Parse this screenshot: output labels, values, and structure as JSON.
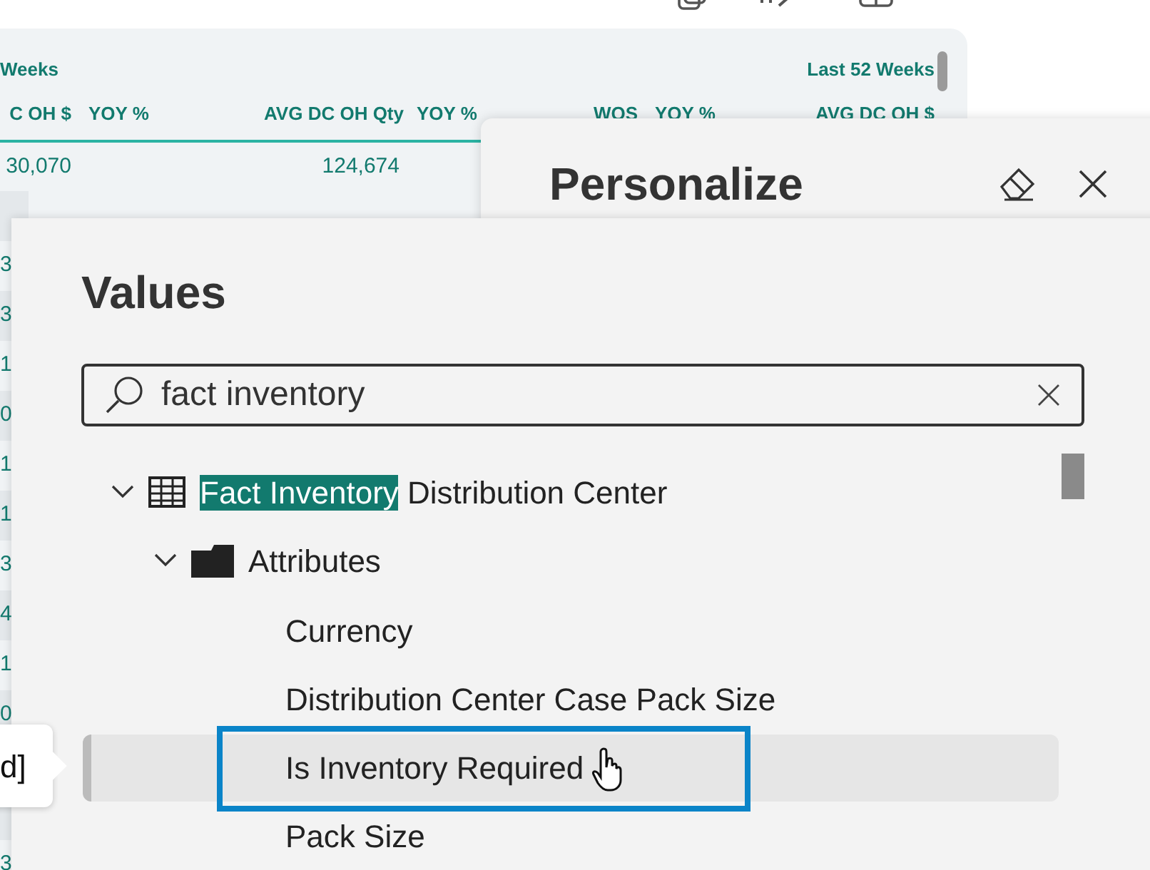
{
  "report": {
    "header_groups": [
      "Weeks",
      "Last 52 Weeks"
    ],
    "columns": [
      "C OH $",
      "YOY %",
      "AVG DC OH Qty",
      "YOY %",
      "WOS",
      "YOY %",
      "AVG DC OH $"
    ],
    "rows": [
      [
        "30,070",
        "",
        "124,674"
      ]
    ],
    "cut_cells": [
      "",
      "3",
      "3",
      "1",
      "0",
      "1",
      "1",
      "3",
      "4",
      "1",
      "0",
      "",
      "",
      "3"
    ]
  },
  "personalize": {
    "title": "Personalize"
  },
  "values_pane": {
    "title": "Values",
    "search": {
      "value": "fact inventory"
    },
    "tree": [
      {
        "match": "Fact Inventory",
        "rest": " Distribution Center",
        "expanded": true,
        "children": [
          {
            "label": "Attributes",
            "expanded": true,
            "children": [
              {
                "label": "Currency",
                "hovered": false,
                "focused": false
              },
              {
                "label": "Distribution Center Case Pack Size",
                "hovered": false,
                "focused": false
              },
              {
                "label": "Is Inventory Required",
                "hovered": true,
                "focused": true
              },
              {
                "label": "Pack Size",
                "hovered": false,
                "focused": false
              }
            ]
          }
        ]
      }
    ]
  },
  "tooltip": {
    "text": "d]"
  }
}
